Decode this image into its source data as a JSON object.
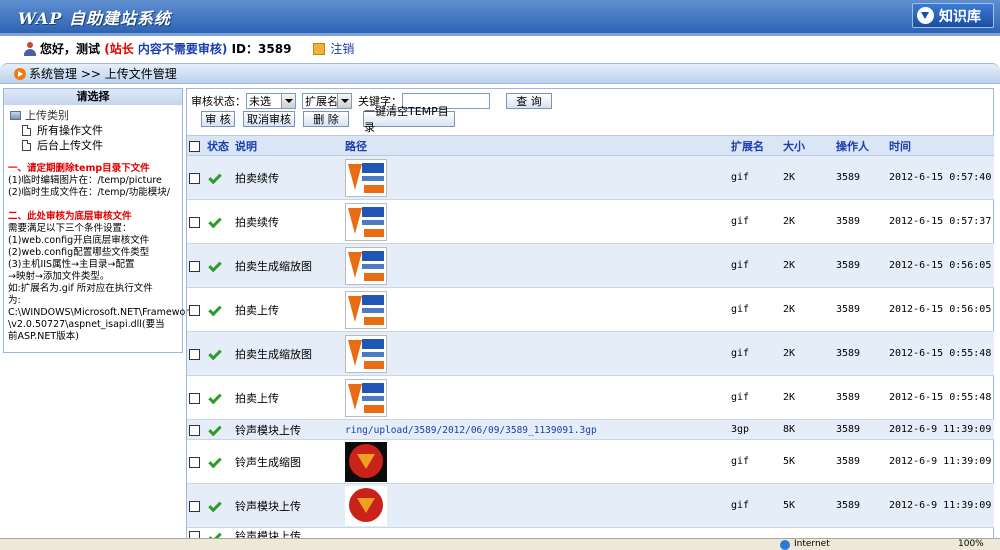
{
  "header": {
    "title": "WAP 自助建站系统",
    "kb_button": "知识库"
  },
  "userbar": {
    "greeting": "您好，",
    "name": "测试",
    "role": "(站长",
    "audit": "内容不需要审核)",
    "id": "ID：3589",
    "logout": "注销"
  },
  "breadcrumb": "系统管理 >> 上传文件管理",
  "sidebar": {
    "heading": "请选择",
    "root": "上传类别",
    "items": [
      "所有操作文件",
      "后台上传文件"
    ],
    "note1_title": "一、请定期删除temp目录下文件",
    "note1_lines": [
      "(1)临时编辑图片在：/temp/picture",
      "(2)临时生成文件在：/temp/功能模块/"
    ],
    "note2_title": "二、此处审核为底层审核文件",
    "note2_lines": [
      "需要满足以下三个条件设置：",
      "(1)web.config开启底层审核文件",
      "(2)web.config配置哪些文件类型",
      "(3)主机IIS属性→主目录→配置",
      "→映射→添加文件类型。",
      "如:扩展名为.gif 所对应在执行文件",
      "为:",
      "C:\\WINDOWS\\Microsoft.NET\\Framework",
      "\\v2.0.50727\\aspnet_isapi.dll(要当",
      "前ASP.NET版本)"
    ]
  },
  "filter": {
    "status_label": "审核状态：",
    "status_value": "未选",
    "ext_value": "扩展名",
    "keyword_label": "关键字：",
    "search_btn": "查 询",
    "approve_btn": "审 核",
    "cancel_btn": "取消审核",
    "delete_btn": "删 除",
    "clear_btn": "一键清空TEMP目录"
  },
  "table": {
    "headers": [
      "状态",
      "说明",
      "路径",
      "扩展名",
      "大小",
      "操作人",
      "时间"
    ],
    "rows": [
      {
        "desc": "拍卖续传",
        "path": "",
        "thumb": "logo",
        "ext": "gif",
        "size": "2K",
        "user": "3589",
        "time": "2012-6-15 0:57:40"
      },
      {
        "desc": "拍卖续传",
        "path": "",
        "thumb": "logo",
        "ext": "gif",
        "size": "2K",
        "user": "3589",
        "time": "2012-6-15 0:57:37"
      },
      {
        "desc": "拍卖生成缩放图",
        "path": "",
        "thumb": "logo",
        "ext": "gif",
        "size": "2K",
        "user": "3589",
        "time": "2012-6-15 0:56:05"
      },
      {
        "desc": "拍卖上传",
        "path": "",
        "thumb": "logo",
        "ext": "gif",
        "size": "2K",
        "user": "3589",
        "time": "2012-6-15 0:56:05"
      },
      {
        "desc": "拍卖生成缩放图",
        "path": "",
        "thumb": "logo",
        "ext": "gif",
        "size": "2K",
        "user": "3589",
        "time": "2012-6-15 0:55:48"
      },
      {
        "desc": "拍卖上传",
        "path": "",
        "thumb": "logo",
        "ext": "gif",
        "size": "2K",
        "user": "3589",
        "time": "2012-6-15 0:55:48"
      },
      {
        "desc": "铃声模块上传",
        "path": "ring/upload/3589/2012/06/09/3589_1139091.3gp",
        "thumb": "",
        "ext": "3gp",
        "size": "8K",
        "user": "3589",
        "time": "2012-6-9 11:39:09"
      },
      {
        "desc": "铃声生成缩图",
        "path": "",
        "thumb": "ring",
        "ext": "gif",
        "size": "5K",
        "user": "3589",
        "time": "2012-6-9 11:39:09"
      },
      {
        "desc": "铃声模块上传",
        "path": "",
        "thumb": "ring-white",
        "ext": "gif",
        "size": "5K",
        "user": "3589",
        "time": "2012-6-9 11:39:09"
      },
      {
        "desc": "铃声模块上传",
        "path": "",
        "thumb": "",
        "ext": "",
        "size": "",
        "user": "",
        "time": ""
      }
    ]
  },
  "statusbar": {
    "zone": "Internet",
    "zoom": "100%"
  },
  "colors": {
    "banner": "#2d63b2",
    "header_row": "#dae6f5",
    "alt_row": "#e4edf8",
    "accent_red": "#e00000",
    "link_blue": "#1b3fae"
  }
}
